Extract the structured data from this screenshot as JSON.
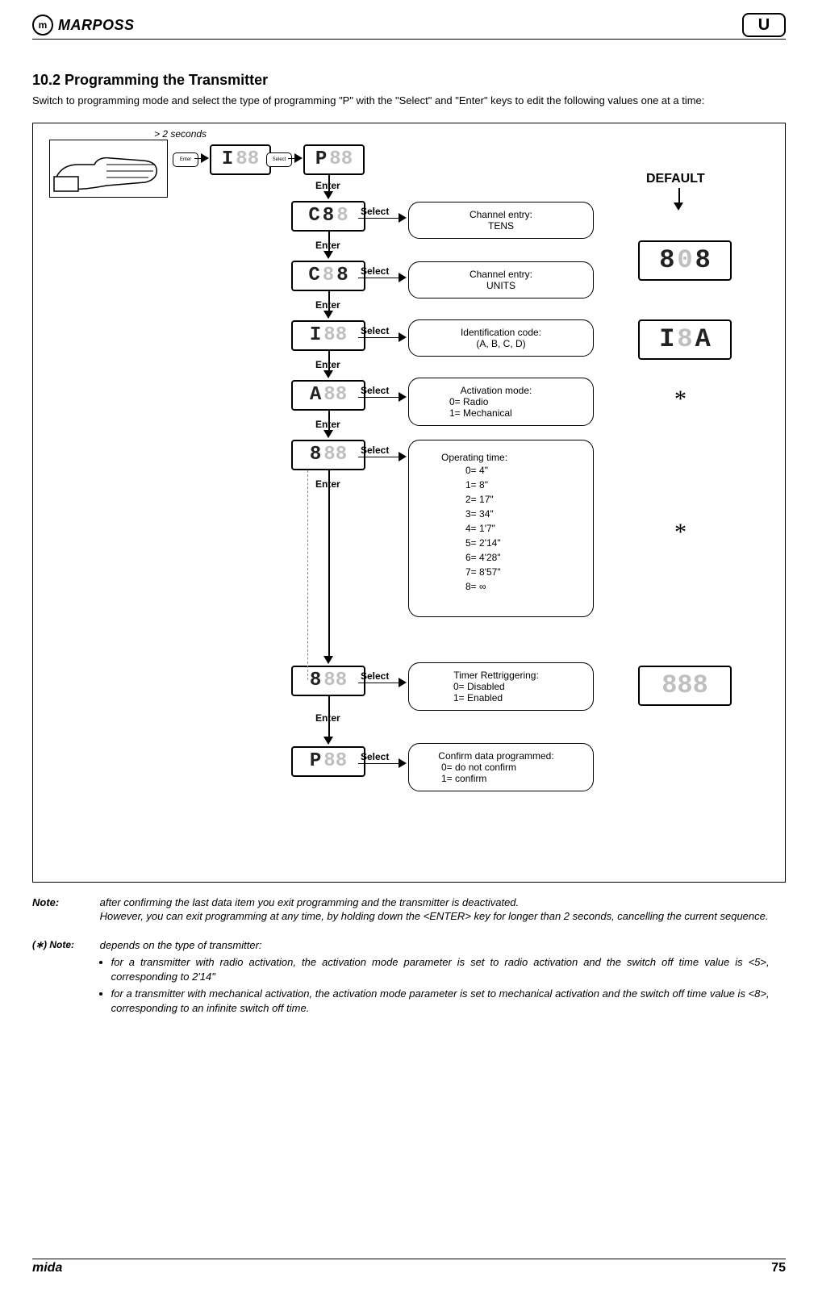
{
  "header": {
    "brand": "MARPOSS",
    "badge": "U",
    "logo_letter": "m"
  },
  "section": {
    "number_title": "10.2      Programming the Transmitter",
    "intro": "Switch to programming mode and select the type of programming \"P\" with the \"Select\" and \"Enter\" keys to edit the following values one at a time:"
  },
  "diagram": {
    "hold_hint": "> 2 seconds",
    "btn_enter": "Enter",
    "btn_select": "Select",
    "default_label": "DEFAULT",
    "displays": {
      "top_I": {
        "black": "I",
        "gray": "88"
      },
      "top_P": {
        "black": "P",
        "gray": "88"
      },
      "C8_tens": {
        "black_pre": "C",
        "black_mid": "8",
        "gray": "8"
      },
      "C8_units": {
        "black_pre": "C",
        "gray": "8",
        "black_end": "8"
      },
      "I_small": {
        "black": "I",
        "gray": "88"
      },
      "A_small": {
        "black": "A",
        "gray": "88"
      },
      "eight1": {
        "black": "8",
        "gray": "88"
      },
      "eight2": {
        "black": "8",
        "gray": "88"
      },
      "P_small": {
        "black": "P",
        "gray": "88"
      },
      "default_808": {
        "black_pre": "8",
        "gray": "0",
        "black_end": "8"
      },
      "default_I8A": {
        "black_pre": "I",
        "gray": "8",
        "black_end": "A"
      },
      "default_888": {
        "gray": "888"
      }
    },
    "boxes": {
      "tens": {
        "l1": "Channel entry:",
        "l2": "TENS"
      },
      "units": {
        "l1": "Channel entry:",
        "l2": "UNITS"
      },
      "id": {
        "l1": "Identification code:",
        "l2": "(A, B, C, D)"
      },
      "activ": {
        "l1": "Activation mode:",
        "l2": "0= Radio",
        "l3": "1= Mechanical"
      },
      "optime": {
        "title": "Operating time:",
        "rows": [
          "0= 4\"",
          "1= 8\"",
          "2= 17\"",
          "3= 34\"",
          "4= 1'7\"",
          "5= 2'14\"",
          "6= 4'28\"",
          "7= 8'57\"",
          "8= ∞"
        ]
      },
      "timer": {
        "l1": "Timer Rettriggering:",
        "l2": "0= Disabled",
        "l3": "1= Enabled"
      },
      "confirm": {
        "l1": "Confirm data programmed:",
        "l2": "0= do not confirm",
        "l3": "1= confirm"
      }
    },
    "star": "*"
  },
  "notes": {
    "label": "Note:",
    "starlabel": "(∗) Note:",
    "n1a": "after confirming the last data item you exit programming and the transmitter is deactivated.",
    "n1b": "However, you can exit programming at any time, by holding down the <ENTER> key for longer than 2 seconds, cancelling the current sequence.",
    "n2intro": "depends on the type of transmitter:",
    "n2a": "for a transmitter with radio activation, the activation mode parameter is set to radio activation and the switch off time value is <5>, corresponding to 2'14\"",
    "n2b": "for a transmitter with mechanical activation, the activation mode parameter is set to mechanical activation and the switch off time value is <8>, corresponding to an infinite switch off time."
  },
  "footer": {
    "left": "mida",
    "right": "75"
  }
}
